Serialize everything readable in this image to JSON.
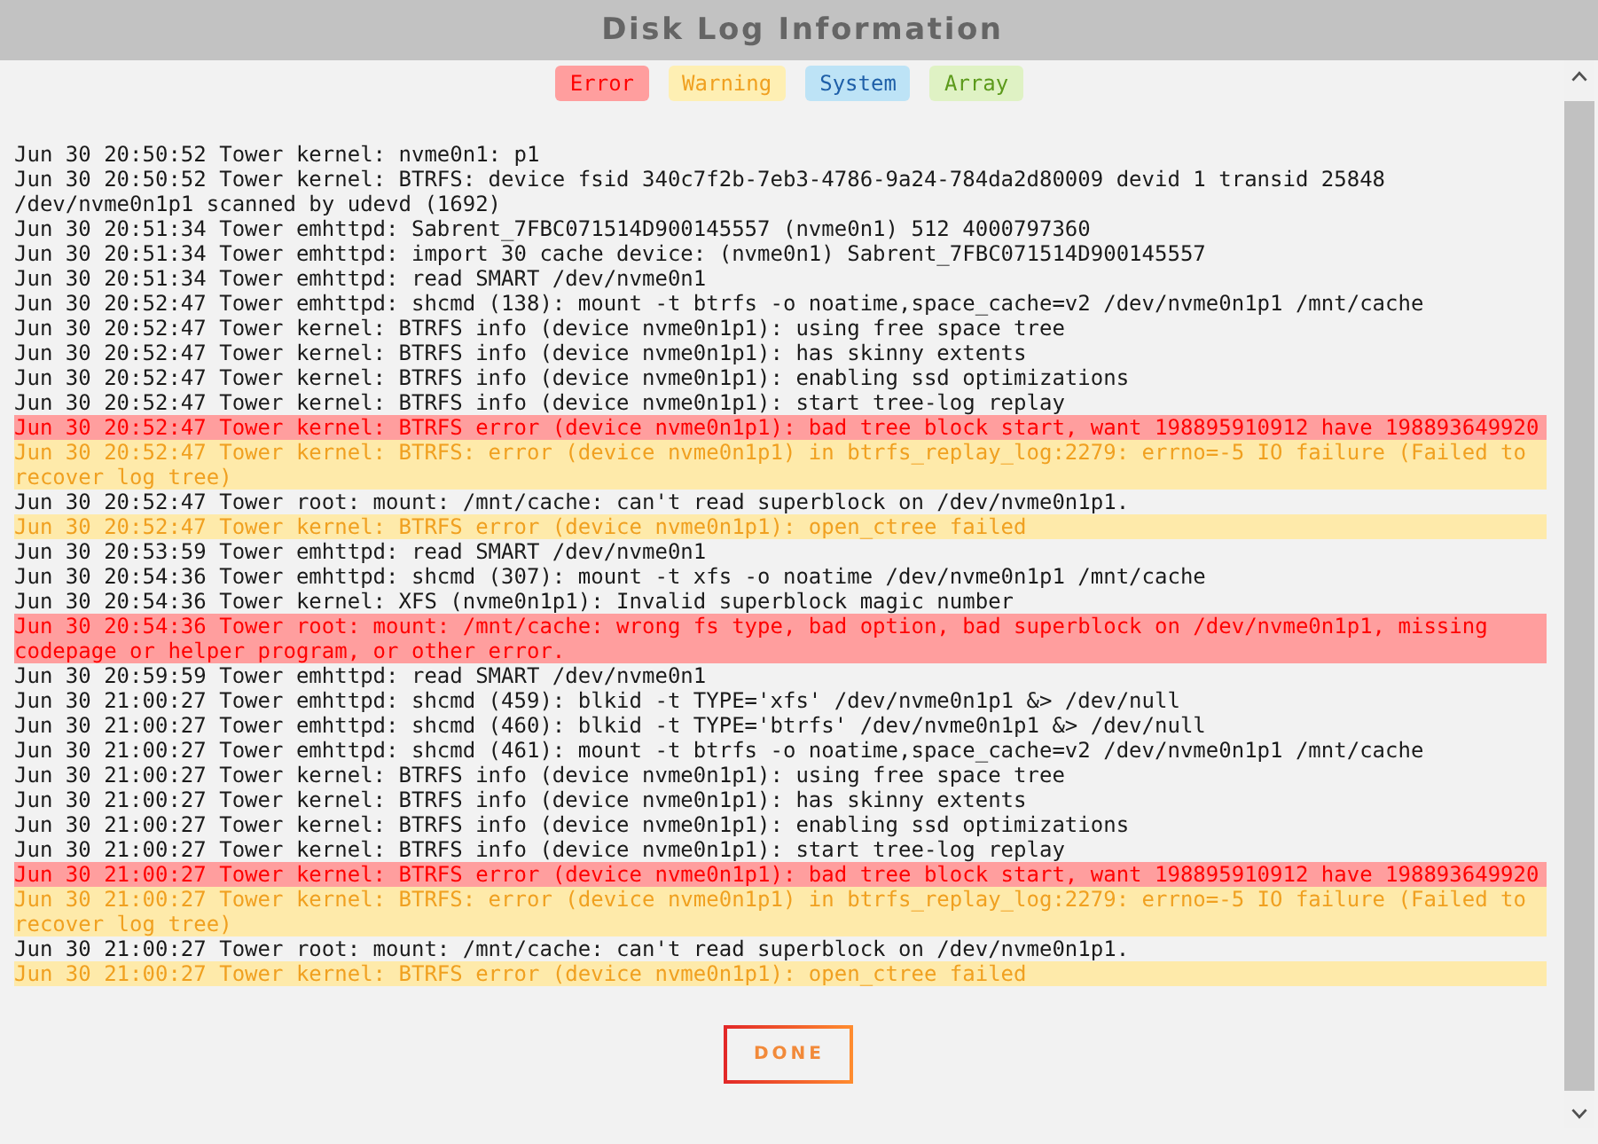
{
  "window": {
    "title": "Disk Log Information"
  },
  "legend": [
    {
      "label": "Error",
      "kind": "error"
    },
    {
      "label": "Warning",
      "kind": "warning"
    },
    {
      "label": "System",
      "kind": "system"
    },
    {
      "label": "Array",
      "kind": "array"
    }
  ],
  "log_lines": [
    {
      "text": "Jun 30 20:50:52 Tower kernel: nvme0n1: p1",
      "kind": "plain"
    },
    {
      "text": "Jun 30 20:50:52 Tower kernel: BTRFS: device fsid 340c7f2b-7eb3-4786-9a24-784da2d80009 devid 1 transid 25848 /dev/nvme0n1p1 scanned by udevd (1692)",
      "kind": "plain"
    },
    {
      "text": "Jun 30 20:51:34 Tower emhttpd: Sabrent_7FBC071514D900145557 (nvme0n1) 512 4000797360",
      "kind": "plain"
    },
    {
      "text": "Jun 30 20:51:34 Tower emhttpd: import 30 cache device: (nvme0n1) Sabrent_7FBC071514D900145557",
      "kind": "plain"
    },
    {
      "text": "Jun 30 20:51:34 Tower emhttpd: read SMART /dev/nvme0n1",
      "kind": "plain"
    },
    {
      "text": "Jun 30 20:52:47 Tower emhttpd: shcmd (138): mount -t btrfs -o noatime,space_cache=v2 /dev/nvme0n1p1 /mnt/cache",
      "kind": "plain"
    },
    {
      "text": "Jun 30 20:52:47 Tower kernel: BTRFS info (device nvme0n1p1): using free space tree",
      "kind": "plain"
    },
    {
      "text": "Jun 30 20:52:47 Tower kernel: BTRFS info (device nvme0n1p1): has skinny extents",
      "kind": "plain"
    },
    {
      "text": "Jun 30 20:52:47 Tower kernel: BTRFS info (device nvme0n1p1): enabling ssd optimizations",
      "kind": "plain"
    },
    {
      "text": "Jun 30 20:52:47 Tower kernel: BTRFS info (device nvme0n1p1): start tree-log replay",
      "kind": "plain"
    },
    {
      "text": "Jun 30 20:52:47 Tower kernel: BTRFS error (device nvme0n1p1): bad tree block start, want 198895910912 have 198893649920",
      "kind": "error"
    },
    {
      "text": "Jun 30 20:52:47 Tower kernel: BTRFS: error (device nvme0n1p1) in btrfs_replay_log:2279: errno=-5 IO failure (Failed to recover log tree)",
      "kind": "warning"
    },
    {
      "text": "Jun 30 20:52:47 Tower root: mount: /mnt/cache: can't read superblock on /dev/nvme0n1p1.",
      "kind": "plain"
    },
    {
      "text": "Jun 30 20:52:47 Tower kernel: BTRFS error (device nvme0n1p1): open_ctree failed",
      "kind": "warning"
    },
    {
      "text": "Jun 30 20:53:59 Tower emhttpd: read SMART /dev/nvme0n1",
      "kind": "plain"
    },
    {
      "text": "Jun 30 20:54:36 Tower emhttpd: shcmd (307): mount -t xfs -o noatime /dev/nvme0n1p1 /mnt/cache",
      "kind": "plain"
    },
    {
      "text": "Jun 30 20:54:36 Tower kernel: XFS (nvme0n1p1): Invalid superblock magic number",
      "kind": "plain"
    },
    {
      "text": "Jun 30 20:54:36 Tower root: mount: /mnt/cache: wrong fs type, bad option, bad superblock on /dev/nvme0n1p1, missing codepage or helper program, or other error.",
      "kind": "error"
    },
    {
      "text": "Jun 30 20:59:59 Tower emhttpd: read SMART /dev/nvme0n1",
      "kind": "plain"
    },
    {
      "text": "Jun 30 21:00:27 Tower emhttpd: shcmd (459): blkid -t TYPE='xfs' /dev/nvme0n1p1 &> /dev/null",
      "kind": "plain"
    },
    {
      "text": "Jun 30 21:00:27 Tower emhttpd: shcmd (460): blkid -t TYPE='btrfs' /dev/nvme0n1p1 &> /dev/null",
      "kind": "plain"
    },
    {
      "text": "Jun 30 21:00:27 Tower emhttpd: shcmd (461): mount -t btrfs -o noatime,space_cache=v2 /dev/nvme0n1p1 /mnt/cache",
      "kind": "plain"
    },
    {
      "text": "Jun 30 21:00:27 Tower kernel: BTRFS info (device nvme0n1p1): using free space tree",
      "kind": "plain"
    },
    {
      "text": "Jun 30 21:00:27 Tower kernel: BTRFS info (device nvme0n1p1): has skinny extents",
      "kind": "plain"
    },
    {
      "text": "Jun 30 21:00:27 Tower kernel: BTRFS info (device nvme0n1p1): enabling ssd optimizations",
      "kind": "plain"
    },
    {
      "text": "Jun 30 21:00:27 Tower kernel: BTRFS info (device nvme0n1p1): start tree-log replay",
      "kind": "plain"
    },
    {
      "text": "Jun 30 21:00:27 Tower kernel: BTRFS error (device nvme0n1p1): bad tree block start, want 198895910912 have 198893649920",
      "kind": "error"
    },
    {
      "text": "Jun 30 21:00:27 Tower kernel: BTRFS: error (device nvme0n1p1) in btrfs_replay_log:2279: errno=-5 IO failure (Failed to recover log tree)",
      "kind": "warning"
    },
    {
      "text": "Jun 30 21:00:27 Tower root: mount: /mnt/cache: can't read superblock on /dev/nvme0n1p1.",
      "kind": "plain"
    },
    {
      "text": "Jun 30 21:00:27 Tower kernel: BTRFS error (device nvme0n1p1): open_ctree failed",
      "kind": "warning"
    }
  ],
  "buttons": [
    "DONE"
  ]
}
